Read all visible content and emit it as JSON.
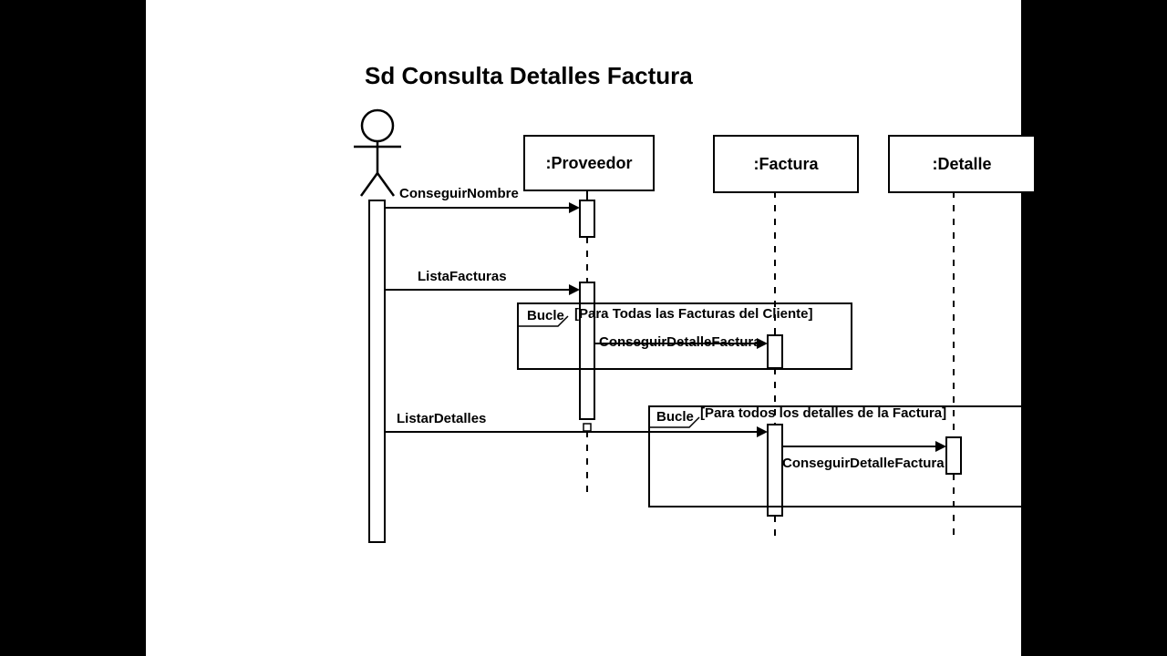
{
  "title": "Sd Consulta Detalles Factura",
  "lifelines": {
    "actor": "Actor",
    "proveedor": ":Proveedor",
    "factura": ":Factura",
    "detalle": ":Detalle"
  },
  "messages": {
    "conseguirNombre": "ConseguirNombre",
    "listaFacturas": "ListaFacturas",
    "conseguirDetalleFactura1": "ConseguirDetalleFactura",
    "listarDetalles": "ListarDetalles",
    "conseguirDetalleFactura2": "ConseguirDetalleFactura"
  },
  "fragments": {
    "loop1": {
      "label": "Bucle",
      "guard": "[Para Todas las Facturas del Cliente]"
    },
    "loop2": {
      "label": "Bucle",
      "guard": "[Para todos los detalles de la Factura]"
    }
  }
}
